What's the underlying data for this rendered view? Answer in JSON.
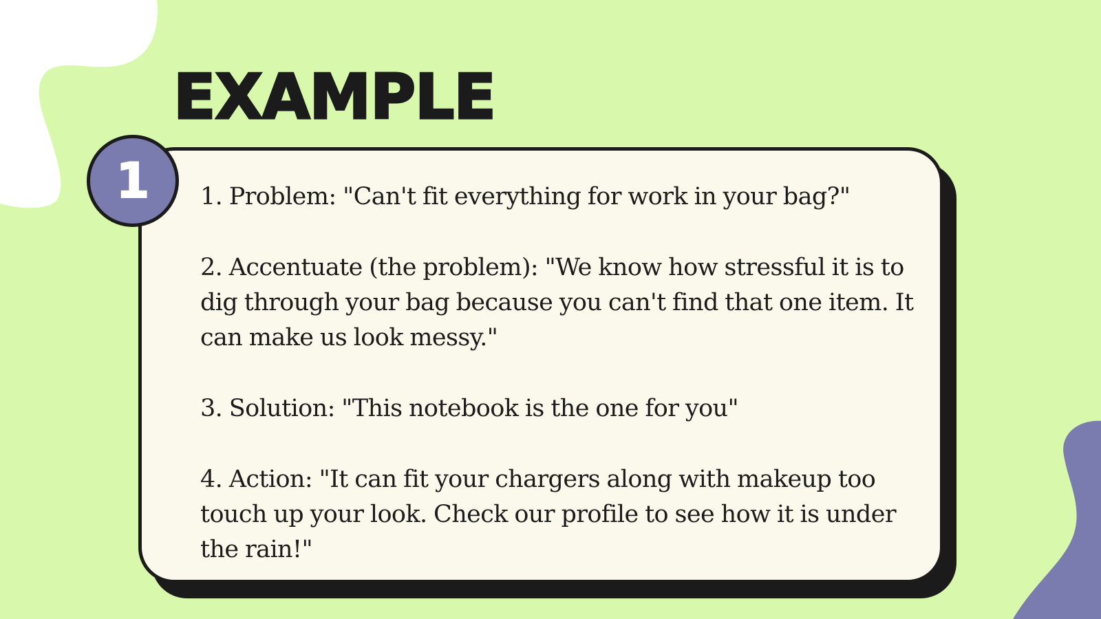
{
  "colors": {
    "background": "#d8f9ab",
    "card_fill": "#fbf8ec",
    "outline": "#1b1b1b",
    "accent_purple": "#7a7cb0",
    "blob_white": "#ffffff"
  },
  "title": "EXAMPLE",
  "badge": {
    "number": "1"
  },
  "steps": [
    "1. Problem: \"Can't fit everything for work in your bag?\"",
    "2. Accentuate (the problem): \"We know how stressful it is to dig through your bag because you can't find that one item. It can make us look messy.\"",
    "3. Solution: \"This notebook is the one for you\"",
    "4. Action: \"It can fit your chargers along with makeup too touch up your look. Check our profile to see how it is under the rain!\""
  ]
}
